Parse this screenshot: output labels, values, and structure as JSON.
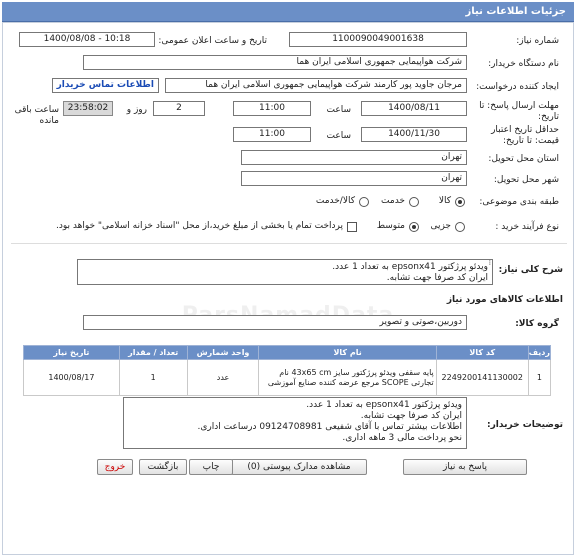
{
  "header_title": "جزئیات اطلاعات نیاز",
  "fields": {
    "need_number_label": "شماره نیاز:",
    "need_number": "1100090049001638",
    "announce_label": "تاریخ و ساعت اعلان عمومی:",
    "announce_value": "1400/08/08 - 10:18",
    "buyer_org_label": "نام دستگاه خریدار:",
    "buyer_org": "شرکت هواپیمایی جمهوری اسلامی ایران هما",
    "creator_label": "ایجاد کننده درخواست:",
    "creator": "مرجان جاوید پور کارمند شرکت هواپیمایی جمهوری اسلامی ایران هما",
    "contact_link": "اطلاعات تماس خریدار",
    "send_deadline_label": "مهلت ارسال پاسخ: تا تاریخ:",
    "send_date": "1400/08/11",
    "hour_label": "ساعت",
    "send_time": "11:00",
    "days_value": "2",
    "days_label": "روز و",
    "remaining_time": "23:58:02",
    "remaining_label": "ساعت باقی مانده",
    "price_validity_label": "حداقل تاریخ اعتبار قیمت: تا تاریخ:",
    "price_date": "1400/11/30",
    "price_time": "11:00",
    "province_label": "استان محل تحویل:",
    "province": "تهران",
    "city_label": "شهر محل تحویل:",
    "city": "تهران",
    "category_label": "طبقه بندی موضوعی:",
    "category_options": [
      "کالا",
      "خدمت",
      "کالا/خدمت"
    ],
    "purchase_type_label": "نوع فرآیند خرید :",
    "purchase_type_options": [
      "جزیی",
      "متوسط"
    ],
    "payment_note": "پرداخت تمام یا بخشی از مبلغ خرید،از محل \"اسناد خزانه اسلامی\" خواهد بود."
  },
  "summary": {
    "label": "شرح کلی نیاز:",
    "lines": [
      "ویدئو پرژکتور epsonx41 به تعداد 1 عدد.",
      "ایران کد صرفا جهت تشابه."
    ]
  },
  "goods_info_title": "اطلاعات کالاهای مورد نیاز",
  "goods_group_label": "گروه کالا:",
  "goods_group": "دوربین،صوتی و تصویر",
  "table": {
    "headers": [
      "ردیف",
      "کد کالا",
      "نام کالا",
      "واحد شمارش",
      "تعداد / مقدار",
      "تاریخ نیاز"
    ],
    "rows": [
      {
        "row": "1",
        "code": "2249200141130002",
        "name": "پایه سقفی ویدئو پرژکتور سایز 43x65 cm نام تجارتی SCOPE مرجع عرضه کننده صنایع آموزشی",
        "unit": "عدد",
        "qty": "1",
        "date": "1400/08/17"
      }
    ]
  },
  "buyer_desc": {
    "label": "توضیحات خریدار:",
    "lines": [
      "ویدئو پرژکتور epsonx41 به تعداد 1 عدد.",
      "ایران کد صرفا جهت تشابه.",
      "اطلاعات بیشتر تماس با آقای شفیعی 09124708981 درساعت اداری.",
      "نحو پرداخت مالی 3 ماهه اداری."
    ]
  },
  "buttons": {
    "reply": "پاسخ به نیاز",
    "docs": "مشاهده مدارک پیوستی (0)",
    "print": "چاپ",
    "back": "بازگشت",
    "exit": "خروج"
  },
  "watermark": "ParsNamadData"
}
